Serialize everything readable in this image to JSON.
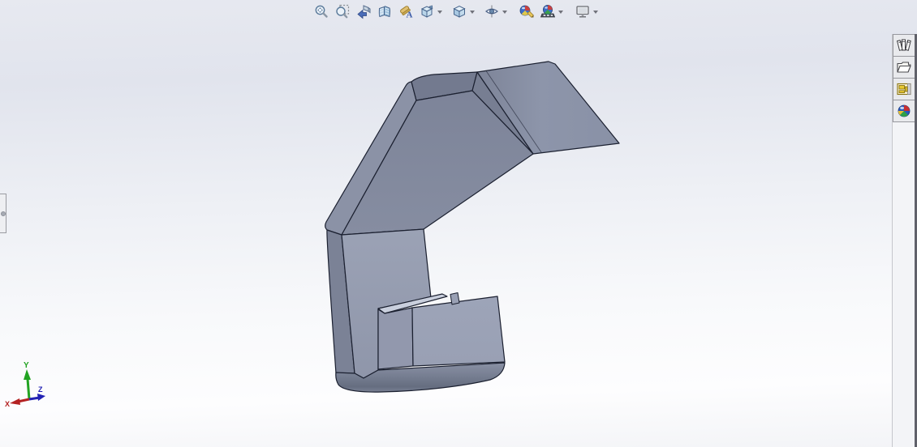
{
  "toolbar": {
    "items": [
      {
        "icon": "zoom-to-fit-icon",
        "has_dropdown": false
      },
      {
        "icon": "zoom-to-area-icon",
        "has_dropdown": false
      },
      {
        "icon": "previous-view-icon",
        "has_dropdown": false
      },
      {
        "icon": "section-view-icon",
        "has_dropdown": false
      },
      {
        "icon": "hide-show-annotations-icon",
        "has_dropdown": false
      },
      {
        "icon": "view-orientation-icon",
        "has_dropdown": true
      },
      {
        "icon": "display-style-icon",
        "has_dropdown": true
      },
      {
        "icon": "hide-show-items-icon",
        "has_dropdown": true
      },
      {
        "icon": "edit-appearance-icon",
        "has_dropdown": false
      },
      {
        "icon": "apply-scene-icon",
        "has_dropdown": true
      },
      {
        "icon": "view-settings-icon",
        "has_dropdown": true
      }
    ]
  },
  "task_pane": {
    "tabs": [
      {
        "icon": "design-library-icon"
      },
      {
        "icon": "file-explorer-icon"
      },
      {
        "icon": "view-palette-icon"
      },
      {
        "icon": "appearances-scenes-icon"
      }
    ]
  },
  "viewport": {
    "background_top": "#e3e6ee",
    "background_bottom": "#fdfdfe",
    "part_color": "#828a9e",
    "part_light_face": "#9aa1b4",
    "part_dark_band": "#737a8f",
    "edge_color": "#1b2030"
  },
  "triad": {
    "axes": [
      {
        "label": "X",
        "color": "#b42222"
      },
      {
        "label": "Y",
        "color": "#22a322"
      },
      {
        "label": "Z",
        "color": "#2222b4"
      }
    ]
  }
}
